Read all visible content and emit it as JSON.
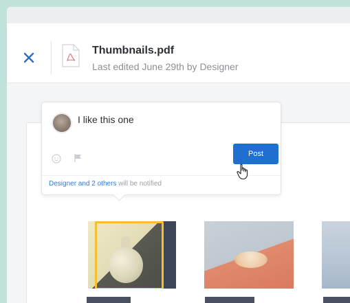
{
  "file": {
    "title": "Thumbnails.pdf",
    "meta": "Last edited June 29th by Designer"
  },
  "comment": {
    "text": "I like this one",
    "post_label": "Post",
    "notify_link": "Designer and 2 others",
    "notify_rest": " will be notified"
  },
  "icons": [
    "close-icon",
    "pdf-file-icon",
    "emoji-icon",
    "flag-icon",
    "hand-cursor-icon"
  ],
  "colors": {
    "accent": "#1f6fd1",
    "selection": "#f3c12d",
    "frame": "#bfe3db"
  }
}
